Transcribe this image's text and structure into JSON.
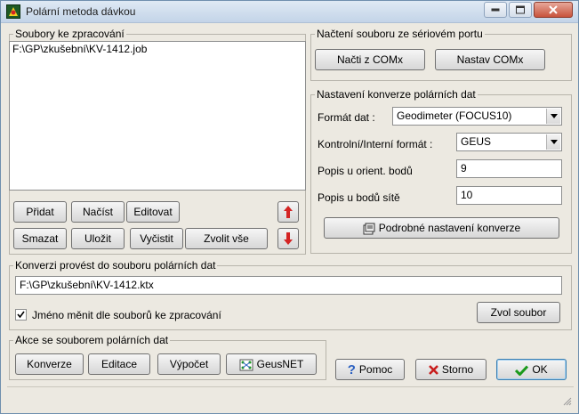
{
  "window": {
    "title": "Polární metoda dávkou",
    "controls": [
      "minimize-icon",
      "maximize-icon",
      "close-icon"
    ]
  },
  "files_group": {
    "legend": "Soubory ke zpracování",
    "items": [
      "F:\\GP\\zkušební\\KV-1412.job"
    ],
    "buttons": {
      "add": "Přidat",
      "load": "Načíst",
      "edit": "Editovat",
      "delete": "Smazat",
      "save": "Uložit",
      "clear": "Vyčistit",
      "select_all": "Zvolit vše"
    },
    "move_up_icon": "arrow-up-icon",
    "move_down_icon": "arrow-down-icon"
  },
  "serial_group": {
    "legend": "Načtení souboru ze sériovém portu",
    "load_button": "Načti z COMx",
    "setup_button": "Nastav COMx"
  },
  "conversion_group": {
    "legend": "Nastavení konverze polárních dat",
    "format_label": "Formát dat :",
    "format_value": "Geodimeter (FOCUS10)",
    "control_format_label": "Kontrolní/Interní formát :",
    "control_format_value": "GEUS",
    "orient_label": "Popis u orient. bodů",
    "orient_value": "9",
    "network_label": "Popis u bodů sítě",
    "network_value": "10",
    "detailed_button": "Podrobné nastavení konverze"
  },
  "output_group": {
    "legend": "Konverzi provést do souboru polárních dat",
    "path": "F:\\GP\\zkušební\\KV-1412.ktx",
    "checkbox_label": "Jméno měnit dle souborů ke zpracování",
    "checkbox_checked": true,
    "choose_button": "Zvol soubor"
  },
  "actions_group": {
    "legend": "Akce se souborem polárních dat",
    "convert": "Konverze",
    "edit": "Editace",
    "compute": "Výpočet",
    "geusnet": "GeusNET"
  },
  "footer": {
    "help": "Pomoc",
    "cancel": "Storno",
    "ok": "OK"
  },
  "colors": {
    "arrow_red": "#d42424",
    "help_blue": "#2a5fc1",
    "cancel_red": "#c81e1e",
    "ok_green": "#1b9a1b"
  }
}
